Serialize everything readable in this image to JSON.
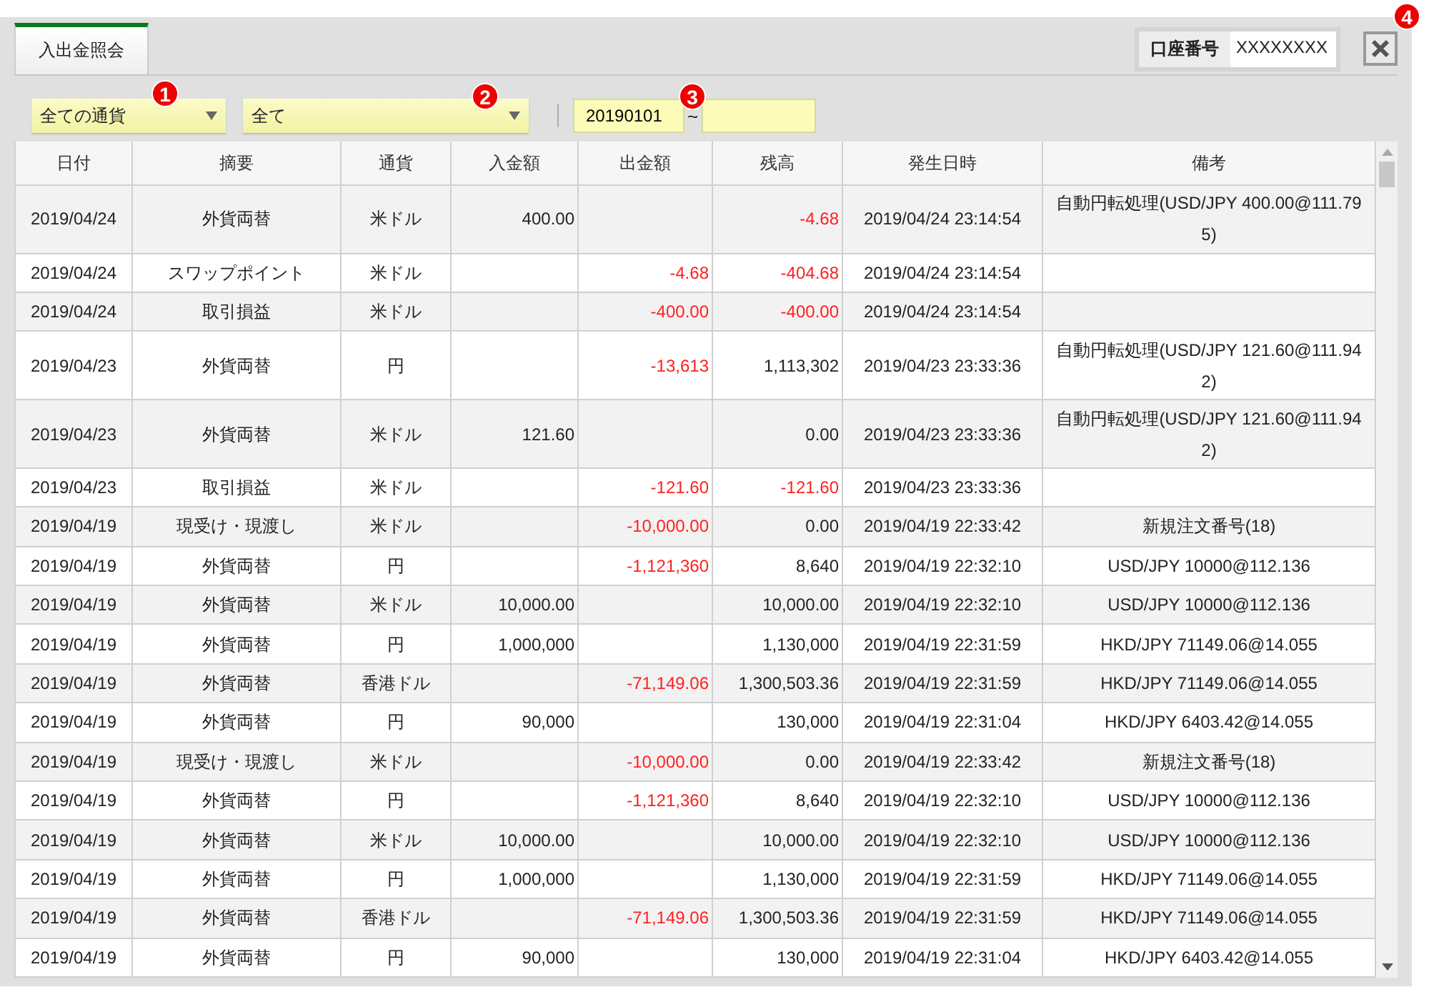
{
  "tabs": [
    {
      "label": "入出金照会",
      "selected": true
    }
  ],
  "account": {
    "label": "口座番号",
    "value": "XXXXXXXX"
  },
  "callouts": [
    "1",
    "2",
    "3",
    "4"
  ],
  "filters": {
    "currency": "全ての通貨",
    "type": "全て",
    "date_from": "20190101",
    "separator": "~"
  },
  "table": {
    "columns": [
      "日付",
      "摘要",
      "通貨",
      "入金額",
      "出金額",
      "残高",
      "発生日時",
      "備考"
    ],
    "rows": [
      {
        "date": "2019/04/24",
        "summary": "外貨両替",
        "currency": "米ドル",
        "deposit": "400.00",
        "withdrawal": "",
        "balance": "-4.68",
        "balance_negative": true,
        "occurred": "2019/04/24 23:14:54",
        "note": "自動円転処理(USD/JPY 400.00@111.795)"
      },
      {
        "date": "2019/04/24",
        "summary": "スワップポイント",
        "currency": "米ドル",
        "deposit": "",
        "withdrawal": "-4.68",
        "balance": "-404.68",
        "balance_negative": true,
        "occurred": "2019/04/24 23:14:54",
        "note": ""
      },
      {
        "date": "2019/04/24",
        "summary": "取引損益",
        "currency": "米ドル",
        "deposit": "",
        "withdrawal": "-400.00",
        "balance": "-400.00",
        "balance_negative": true,
        "occurred": "2019/04/24 23:14:54",
        "note": ""
      },
      {
        "date": "2019/04/23",
        "summary": "外貨両替",
        "currency": "円",
        "deposit": "",
        "withdrawal": "-13,613",
        "balance": "1,113,302",
        "balance_negative": false,
        "occurred": "2019/04/23 23:33:36",
        "note": "自動円転処理(USD/JPY 121.60@111.942)"
      },
      {
        "date": "2019/04/23",
        "summary": "外貨両替",
        "currency": "米ドル",
        "deposit": "121.60",
        "withdrawal": "",
        "balance": "0.00",
        "balance_negative": false,
        "occurred": "2019/04/23 23:33:36",
        "note": "自動円転処理(USD/JPY 121.60@111.942)"
      },
      {
        "date": "2019/04/23",
        "summary": "取引損益",
        "currency": "米ドル",
        "deposit": "",
        "withdrawal": "-121.60",
        "balance": "-121.60",
        "balance_negative": true,
        "occurred": "2019/04/23 23:33:36",
        "note": ""
      },
      {
        "date": "2019/04/19",
        "summary": "現受け・現渡し",
        "currency": "米ドル",
        "deposit": "",
        "withdrawal": "-10,000.00",
        "balance": "0.00",
        "balance_negative": false,
        "occurred": "2019/04/19 22:33:42",
        "note": "新規注文番号(18)"
      },
      {
        "date": "2019/04/19",
        "summary": "外貨両替",
        "currency": "円",
        "deposit": "",
        "withdrawal": "-1,121,360",
        "balance": "8,640",
        "balance_negative": false,
        "occurred": "2019/04/19 22:32:10",
        "note": "USD/JPY 10000@112.136"
      },
      {
        "date": "2019/04/19",
        "summary": "外貨両替",
        "currency": "米ドル",
        "deposit": "10,000.00",
        "withdrawal": "",
        "balance": "10,000.00",
        "balance_negative": false,
        "occurred": "2019/04/19 22:32:10",
        "note": "USD/JPY 10000@112.136"
      },
      {
        "date": "2019/04/19",
        "summary": "外貨両替",
        "currency": "円",
        "deposit": "1,000,000",
        "withdrawal": "",
        "balance": "1,130,000",
        "balance_negative": false,
        "occurred": "2019/04/19 22:31:59",
        "note": "HKD/JPY 71149.06@14.055"
      },
      {
        "date": "2019/04/19",
        "summary": "外貨両替",
        "currency": "香港ドル",
        "deposit": "",
        "withdrawal": "-71,149.06",
        "balance": "1,300,503.36",
        "balance_negative": false,
        "occurred": "2019/04/19 22:31:59",
        "note": "HKD/JPY 71149.06@14.055"
      },
      {
        "date": "2019/04/19",
        "summary": "外貨両替",
        "currency": "円",
        "deposit": "90,000",
        "withdrawal": "",
        "balance": "130,000",
        "balance_negative": false,
        "occurred": "2019/04/19 22:31:04",
        "note": "HKD/JPY 6403.42@14.055"
      },
      {
        "date": "2019/04/19",
        "summary": "現受け・現渡し",
        "currency": "米ドル",
        "deposit": "",
        "withdrawal": "-10,000.00",
        "balance": "0.00",
        "balance_negative": false,
        "occurred": "2019/04/19 22:33:42",
        "note": "新規注文番号(18)"
      },
      {
        "date": "2019/04/19",
        "summary": "外貨両替",
        "currency": "円",
        "deposit": "",
        "withdrawal": "-1,121,360",
        "balance": "8,640",
        "balance_negative": false,
        "occurred": "2019/04/19 22:32:10",
        "note": "USD/JPY 10000@112.136"
      },
      {
        "date": "2019/04/19",
        "summary": "外貨両替",
        "currency": "米ドル",
        "deposit": "10,000.00",
        "withdrawal": "",
        "balance": "10,000.00",
        "balance_negative": false,
        "occurred": "2019/04/19 22:32:10",
        "note": "USD/JPY 10000@112.136"
      },
      {
        "date": "2019/04/19",
        "summary": "外貨両替",
        "currency": "円",
        "deposit": "1,000,000",
        "withdrawal": "",
        "balance": "1,130,000",
        "balance_negative": false,
        "occurred": "2019/04/19 22:31:59",
        "note": "HKD/JPY 71149.06@14.055"
      },
      {
        "date": "2019/04/19",
        "summary": "外貨両替",
        "currency": "香港ドル",
        "deposit": "",
        "withdrawal": "-71,149.06",
        "balance": "1,300,503.36",
        "balance_negative": false,
        "occurred": "2019/04/19 22:31:59",
        "note": "HKD/JPY 71149.06@14.055"
      },
      {
        "date": "2019/04/19",
        "summary": "外貨両替",
        "currency": "円",
        "deposit": "90,000",
        "withdrawal": "",
        "balance": "130,000",
        "balance_negative": false,
        "occurred": "2019/04/19 22:31:04",
        "note": "HKD/JPY 6403.42@14.055"
      }
    ]
  }
}
